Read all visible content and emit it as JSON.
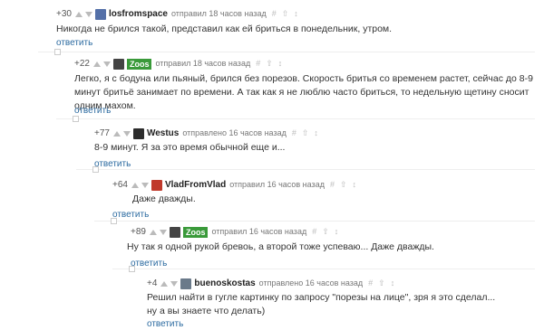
{
  "comments": [
    {
      "rating": "+30",
      "username": "losfromspace",
      "time": "отправил 18 часов назад",
      "text": "Никогда не брился такой, представил как ей бриться в понедельник, утром.",
      "reply": "ответить",
      "avatar_color": "#5470a8"
    },
    {
      "rating": "+22",
      "username": "Zoos",
      "badge": true,
      "time": "отправил 18 часов назад",
      "text": "Легко, я с бодуна или пьяный, брился без порезов. Скорость бритья со временем  растет, сейчас до 8-9 минут бритьё занимает по времени. А так как я не люблю часто бриться, то недельную щетину сносит одним махом.",
      "reply": "ответить",
      "avatar_color": "#444444"
    },
    {
      "rating": "+77",
      "username": "Westus",
      "time": "отправлено 16 часов назад",
      "text": "8-9 минут. Я за это время обычной еще и...",
      "reply": "ответить",
      "avatar_color": "#2c2c2c"
    },
    {
      "rating": "+64",
      "username": "VladFromVlad",
      "time": "отправил 16 часов назад",
      "text": "Даже дважды.",
      "reply": "ответить",
      "avatar_color": "#c0392b"
    },
    {
      "rating": "+89",
      "username": "Zoos",
      "badge": true,
      "time": "отправил 16 часов назад",
      "text": "Ну так я одной рукой бревоь, а второй тоже успеваю... Даже дважды.",
      "reply": "ответить",
      "avatar_color": "#444444"
    },
    {
      "rating": "+4",
      "username": "buenoskostas",
      "time": "отправлено 16 часов назад",
      "text_lines": [
        "Решил найти в гугле картинку по запросу \"порезы на лице\", зря я это сделал...",
        "ну а вы знаете что делать)"
      ],
      "reply": "ответить",
      "avatar_color": "#6a7a8a"
    }
  ],
  "icons": {
    "up": "arrow-up-icon",
    "down": "arrow-down-icon",
    "hash": "#",
    "save": "⇧",
    "link": "↕"
  },
  "colors": {
    "link": "#2b6aa0",
    "badge": "#3a9a3a"
  }
}
